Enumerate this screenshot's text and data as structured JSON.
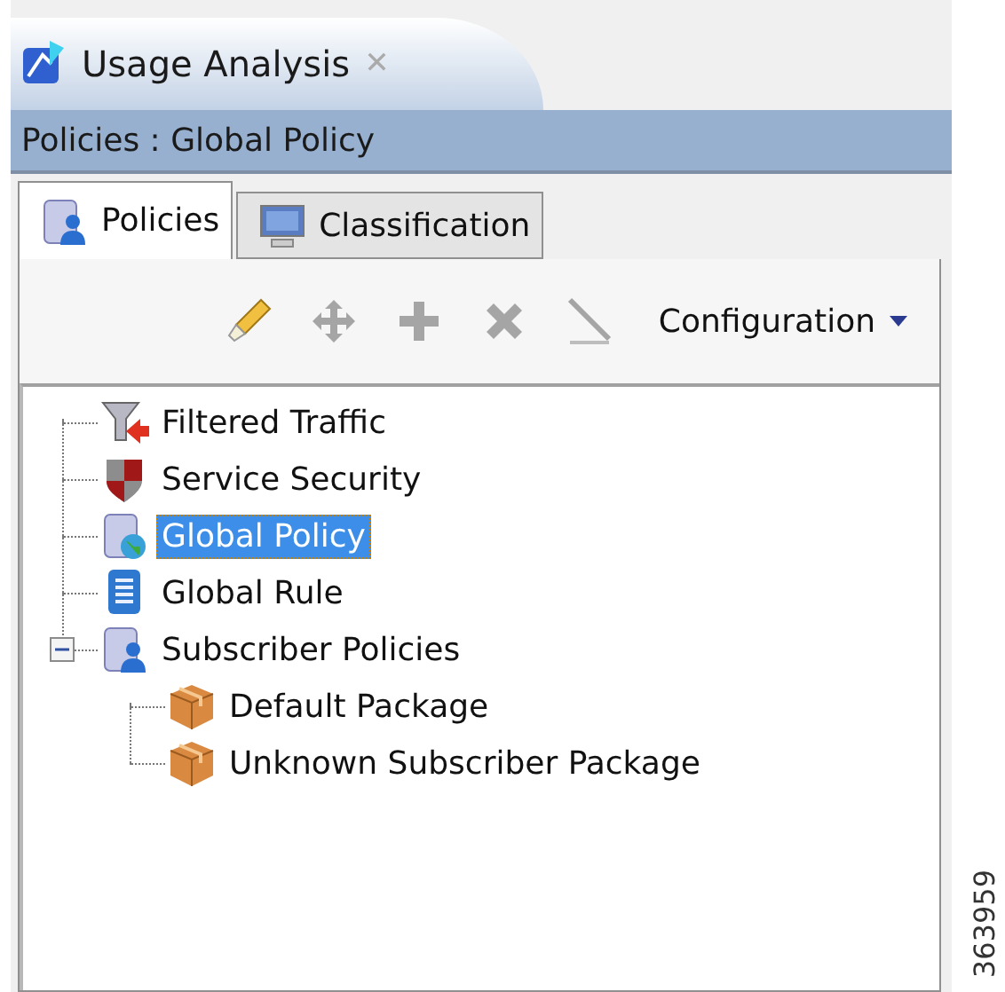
{
  "view_tab": {
    "title": "Usage Analysis",
    "close": "✕"
  },
  "header": {
    "title": "Policies : Global Policy"
  },
  "tabs": [
    {
      "label": "Policies",
      "kind": "policies",
      "selected": true
    },
    {
      "label": "Classification",
      "kind": "classification",
      "selected": false
    }
  ],
  "toolbar": {
    "buttons": [
      {
        "kind": "wand",
        "disabled": false
      },
      {
        "kind": "move",
        "disabled": true
      },
      {
        "kind": "add",
        "disabled": true
      },
      {
        "kind": "delete",
        "disabled": true
      },
      {
        "kind": "line",
        "disabled": true
      }
    ],
    "menu": "Configuration"
  },
  "tree": [
    {
      "label": "Filtered Traffic",
      "kind": "filter",
      "selected": false
    },
    {
      "label": "Service Security",
      "kind": "shield",
      "selected": false
    },
    {
      "label": "Global Policy",
      "kind": "globe",
      "selected": true
    },
    {
      "label": "Global Rule",
      "kind": "scroll",
      "selected": false
    },
    {
      "label": "Subscriber Policies",
      "kind": "user",
      "selected": false,
      "expanded": true,
      "children": [
        {
          "label": "Default Package",
          "kind": "package",
          "selected": false
        },
        {
          "label": "Unknown Subscriber Package",
          "kind": "package",
          "selected": false
        }
      ]
    }
  ],
  "figure_id": "363959"
}
